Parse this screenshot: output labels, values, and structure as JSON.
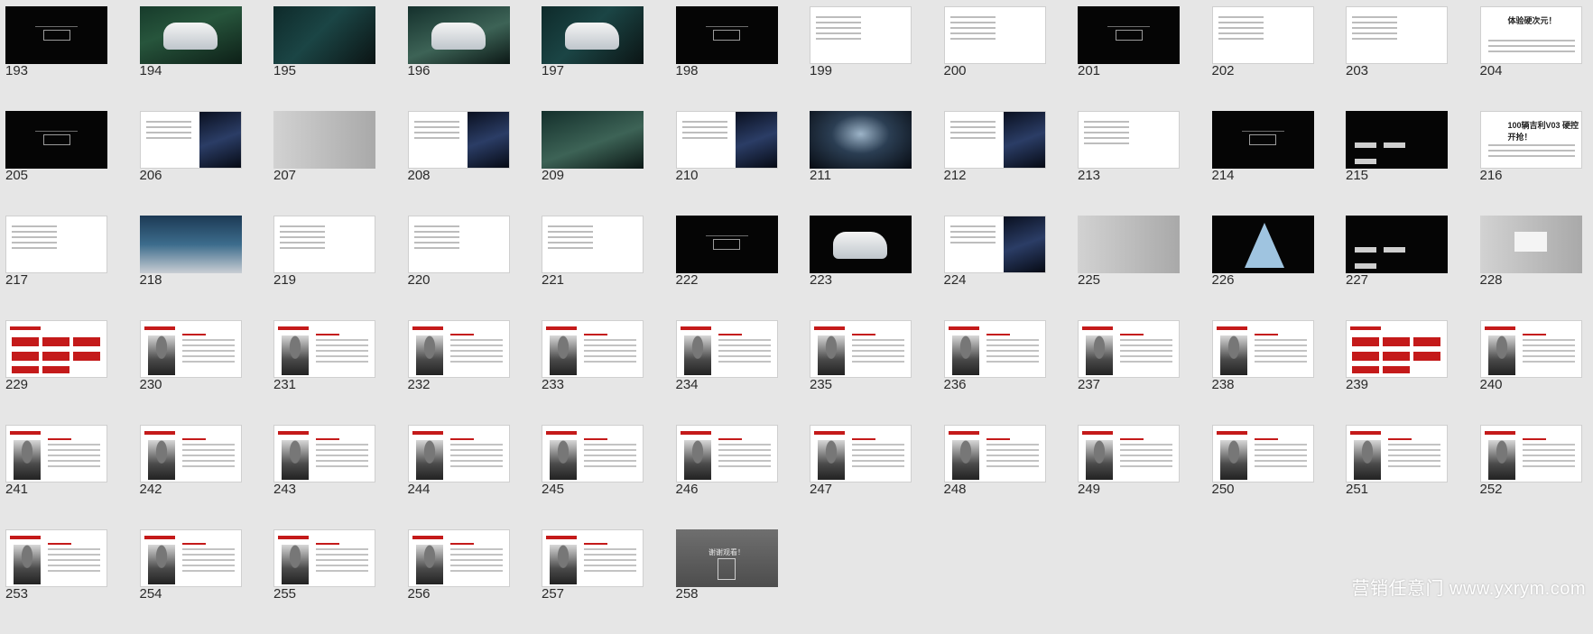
{
  "slides": [
    {
      "n": "193",
      "style": "black",
      "deco": "cap"
    },
    {
      "n": "194",
      "style": "car",
      "deco": "car"
    },
    {
      "n": "195",
      "style": "dark",
      "deco": ""
    },
    {
      "n": "196",
      "style": "road",
      "deco": "car"
    },
    {
      "n": "197",
      "style": "dark",
      "deco": "car"
    },
    {
      "n": "198",
      "style": "black",
      "deco": "cap"
    },
    {
      "n": "199",
      "style": "white",
      "deco": "txt"
    },
    {
      "n": "200",
      "style": "white",
      "deco": "txt"
    },
    {
      "n": "201",
      "style": "black",
      "deco": "cap"
    },
    {
      "n": "202",
      "style": "white",
      "deco": "txt"
    },
    {
      "n": "203",
      "style": "white",
      "deco": "txt"
    },
    {
      "n": "204",
      "style": "white",
      "deco": "bigtext",
      "label": "体验硬次元！"
    },
    {
      "n": "205",
      "style": "black",
      "deco": "cap"
    },
    {
      "n": "206",
      "style": "white",
      "deco": "darkphoto"
    },
    {
      "n": "207",
      "style": "lightgray",
      "deco": ""
    },
    {
      "n": "208",
      "style": "white",
      "deco": "darkphoto"
    },
    {
      "n": "209",
      "style": "road",
      "deco": ""
    },
    {
      "n": "210",
      "style": "white",
      "deco": "darkphoto"
    },
    {
      "n": "211",
      "style": "stage",
      "deco": ""
    },
    {
      "n": "212",
      "style": "white",
      "deco": "darkphoto"
    },
    {
      "n": "213",
      "style": "white",
      "deco": "txt"
    },
    {
      "n": "214",
      "style": "black",
      "deco": "cap"
    },
    {
      "n": "215",
      "style": "black",
      "deco": "arrows"
    },
    {
      "n": "216",
      "style": "white",
      "deco": "bigtext",
      "label": "100辆吉利V03 硬控开抢！"
    },
    {
      "n": "217",
      "style": "white",
      "deco": "txt"
    },
    {
      "n": "218",
      "style": "cars",
      "deco": ""
    },
    {
      "n": "219",
      "style": "white",
      "deco": "txt"
    },
    {
      "n": "220",
      "style": "white",
      "deco": "txt"
    },
    {
      "n": "221",
      "style": "white",
      "deco": "txt"
    },
    {
      "n": "222",
      "style": "black",
      "deco": "cap"
    },
    {
      "n": "223",
      "style": "black",
      "deco": "car"
    },
    {
      "n": "224",
      "style": "white",
      "deco": "darkphoto"
    },
    {
      "n": "225",
      "style": "lightgray",
      "deco": ""
    },
    {
      "n": "226",
      "style": "black",
      "deco": "pyramid"
    },
    {
      "n": "227",
      "style": "black",
      "deco": "arrows"
    },
    {
      "n": "228",
      "style": "lightgray",
      "deco": "card"
    },
    {
      "n": "229",
      "style": "white",
      "deco": "red"
    },
    {
      "n": "230",
      "style": "white",
      "deco": "portrait"
    },
    {
      "n": "231",
      "style": "white",
      "deco": "portrait"
    },
    {
      "n": "232",
      "style": "white",
      "deco": "portrait"
    },
    {
      "n": "233",
      "style": "white",
      "deco": "portrait"
    },
    {
      "n": "234",
      "style": "white",
      "deco": "portrait"
    },
    {
      "n": "235",
      "style": "white",
      "deco": "portrait"
    },
    {
      "n": "236",
      "style": "white",
      "deco": "portrait"
    },
    {
      "n": "237",
      "style": "white",
      "deco": "portrait"
    },
    {
      "n": "238",
      "style": "white",
      "deco": "portrait"
    },
    {
      "n": "239",
      "style": "white",
      "deco": "red"
    },
    {
      "n": "240",
      "style": "white",
      "deco": "portrait"
    },
    {
      "n": "241",
      "style": "white",
      "deco": "portrait"
    },
    {
      "n": "242",
      "style": "white",
      "deco": "portrait"
    },
    {
      "n": "243",
      "style": "white",
      "deco": "portrait"
    },
    {
      "n": "244",
      "style": "white",
      "deco": "portrait"
    },
    {
      "n": "245",
      "style": "white",
      "deco": "portrait"
    },
    {
      "n": "246",
      "style": "white",
      "deco": "portrait"
    },
    {
      "n": "247",
      "style": "white",
      "deco": "portrait"
    },
    {
      "n": "248",
      "style": "white",
      "deco": "portrait"
    },
    {
      "n": "249",
      "style": "white",
      "deco": "portrait"
    },
    {
      "n": "250",
      "style": "white",
      "deco": "portrait"
    },
    {
      "n": "251",
      "style": "white",
      "deco": "portrait"
    },
    {
      "n": "252",
      "style": "white",
      "deco": "portrait"
    },
    {
      "n": "253",
      "style": "white",
      "deco": "portrait"
    },
    {
      "n": "254",
      "style": "white",
      "deco": "portrait"
    },
    {
      "n": "255",
      "style": "white",
      "deco": "portrait"
    },
    {
      "n": "256",
      "style": "white",
      "deco": "portrait"
    },
    {
      "n": "257",
      "style": "white",
      "deco": "portrait"
    },
    {
      "n": "258",
      "style": "gray",
      "deco": "thanks",
      "label": "谢谢观看！"
    }
  ],
  "watermark": "营销任意门 www.yxrym.com",
  "colors": {
    "background": "#e6e6e6",
    "accent": "#c41a1a",
    "text": "#2a2a2a"
  }
}
